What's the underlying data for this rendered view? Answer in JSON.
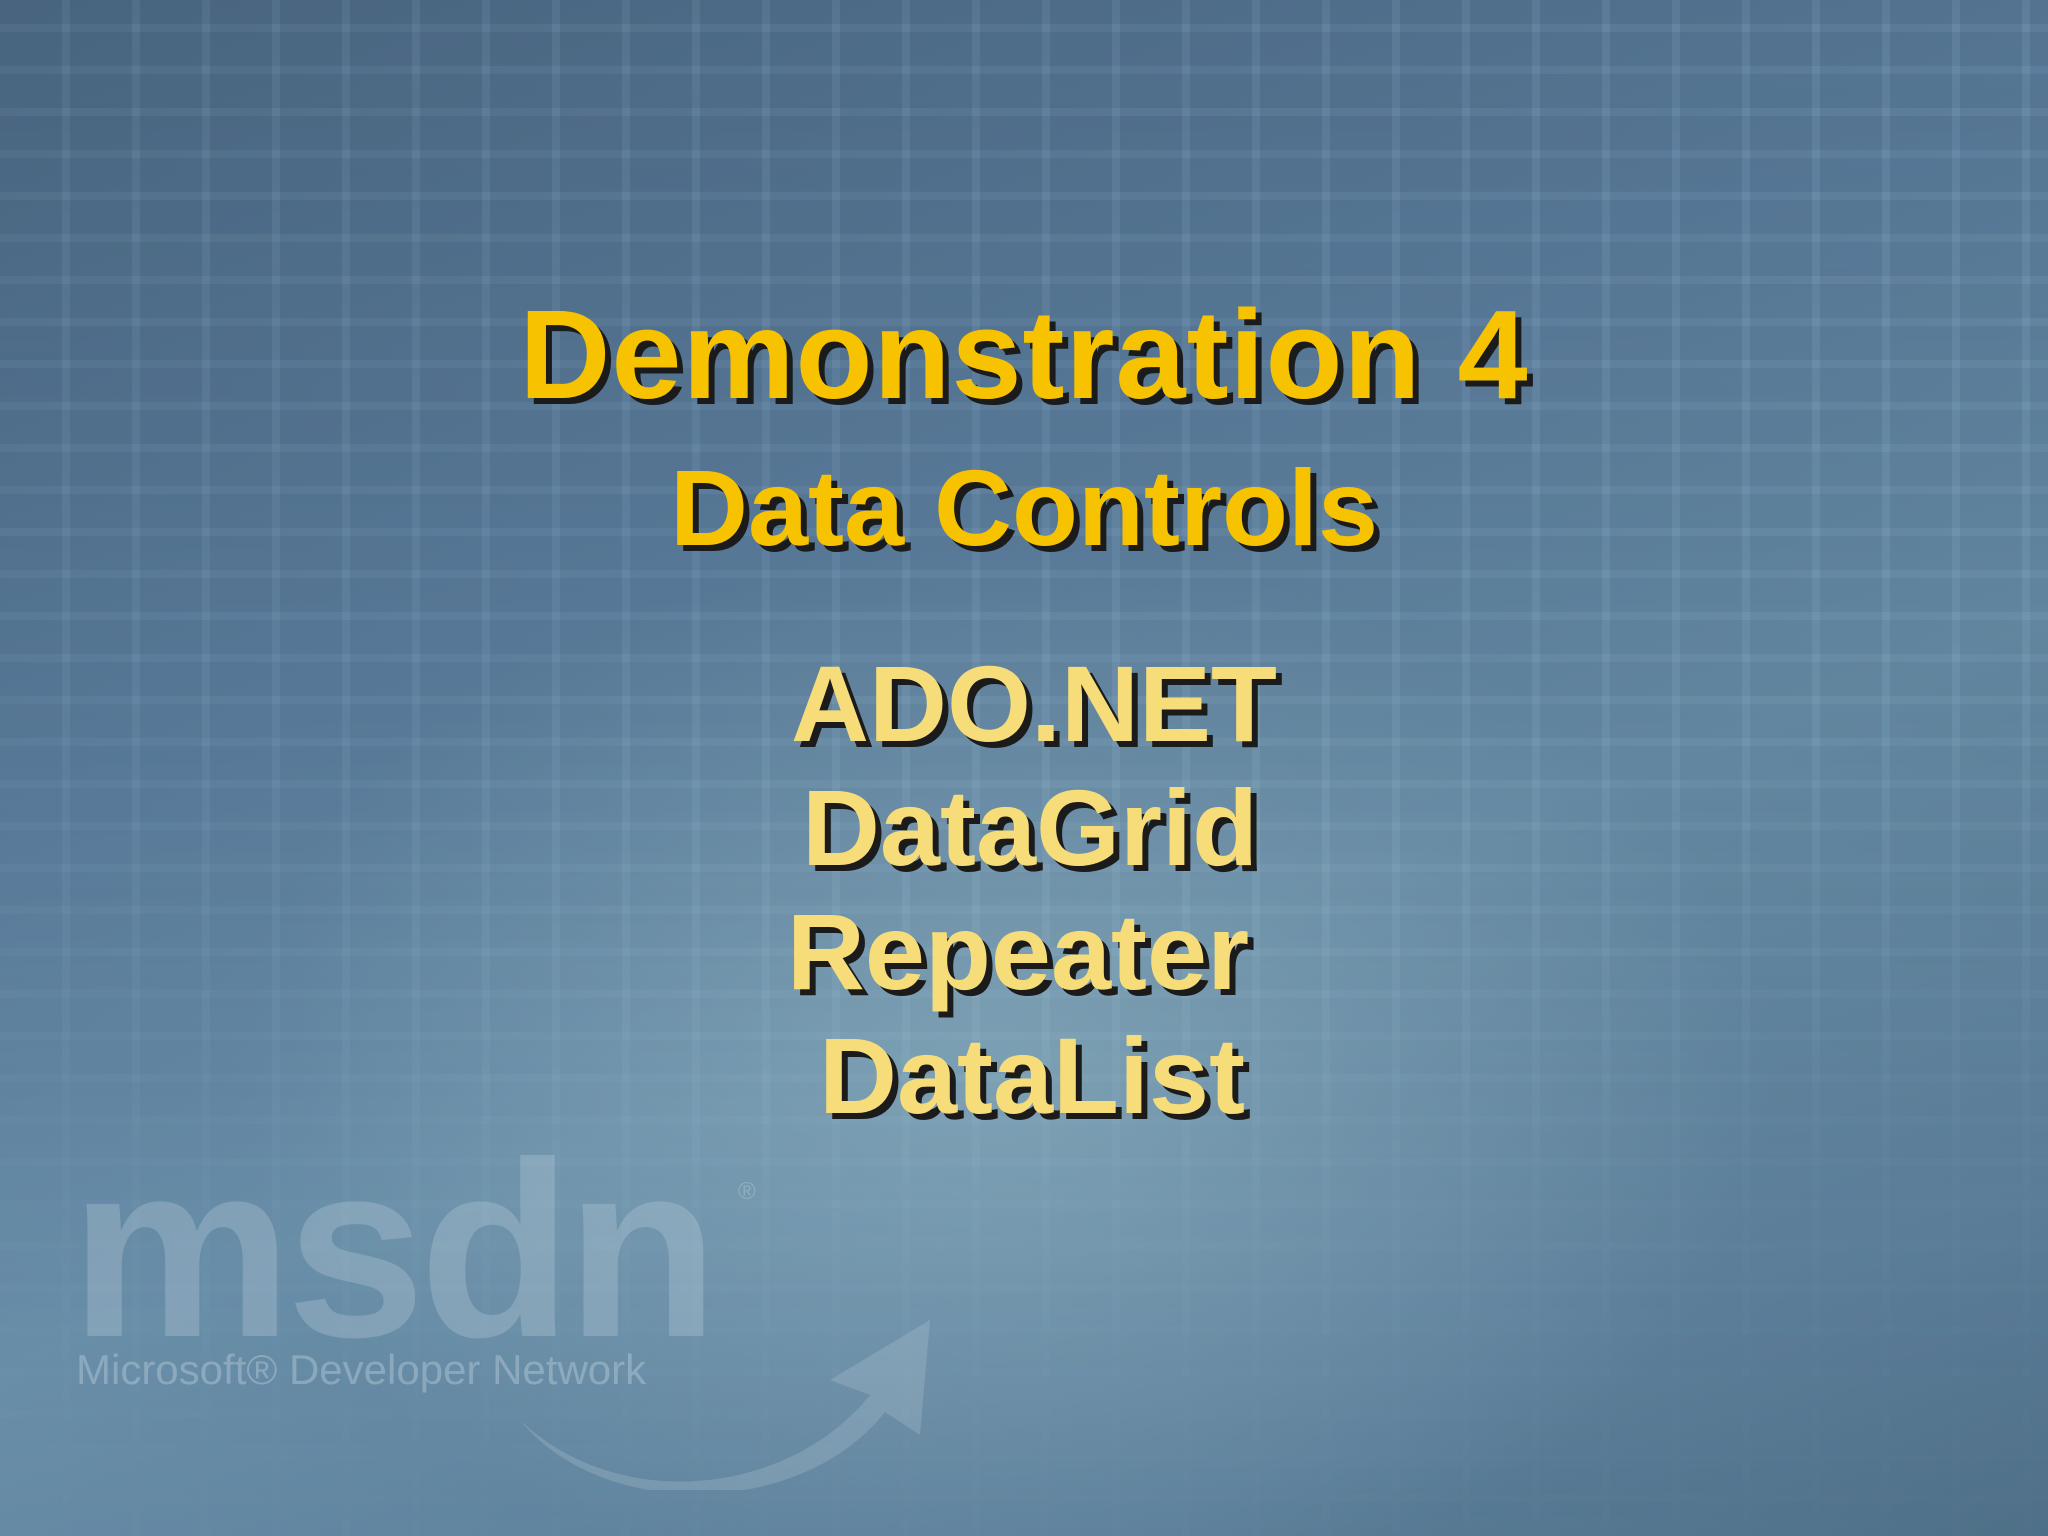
{
  "slide": {
    "title": "Demonstration 4",
    "subtitle": "Data Controls",
    "items": [
      "ADO.NET",
      "DataGrid",
      "Repeater",
      "DataList"
    ]
  },
  "watermark": {
    "brand": "msdn",
    "registered_mark": "®",
    "tagline": "Microsoft® Developer Network",
    "icon": "msdn-swoosh-arrow-icon"
  },
  "colors": {
    "title": "#f7c300",
    "items": "#f7dd7a",
    "shadow": "#1b1b1b",
    "background": "#5d80a0"
  }
}
